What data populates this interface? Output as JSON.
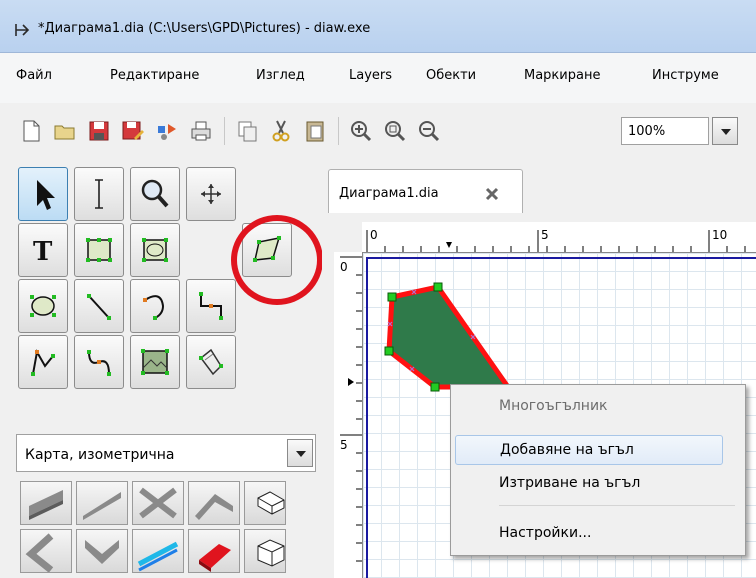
{
  "window": {
    "title": "*Диаграма1.dia (C:\\Users\\GPD\\Pictures) - diaw.exe"
  },
  "menu": [
    "Файл",
    "Редактиране",
    "Изглед",
    "Layers",
    "Обекти",
    "Маркиране",
    "Инструме"
  ],
  "toolbar": {
    "buttons": [
      "new-file-icon",
      "open-folder-icon",
      "save-icon",
      "save-as-icon",
      "export-icon",
      "print-icon",
      "copy-icon",
      "cut-icon",
      "paste-icon",
      "zoom-in-icon",
      "zoom-fit-icon",
      "zoom-out-icon"
    ],
    "zoom_value": "100%"
  },
  "toolbox": {
    "tools": [
      "pointer-icon",
      "text-cursor-icon",
      "magnifier-icon",
      "move-arrows-icon",
      "text-tool-icon",
      "box-icon",
      "image-box-icon",
      "polygon-icon",
      "ellipse-icon",
      "line-icon",
      "arc-icon",
      "zigzag-line-icon",
      "polyline-icon",
      "bezier-line-icon",
      "image-icon",
      "outline-icon"
    ],
    "sheet_name": "Карта, изометрична"
  },
  "tabs": [
    {
      "label": "Диаграма1.dia"
    }
  ],
  "rulers": {
    "h": [
      "0",
      "5",
      "10"
    ],
    "v": [
      "0",
      "5"
    ]
  },
  "context_menu": {
    "title": "Многоъгълник",
    "items": [
      {
        "label": "Добавяне на ъгъл"
      },
      {
        "label": "Изтриване на ъгъл"
      },
      {
        "label": "Настройки..."
      }
    ]
  },
  "colors": {
    "shape_fill": "#2f7a4a",
    "shape_stroke": "#ff1111",
    "handle": "#22cc22",
    "highlight": "#e0141e"
  }
}
